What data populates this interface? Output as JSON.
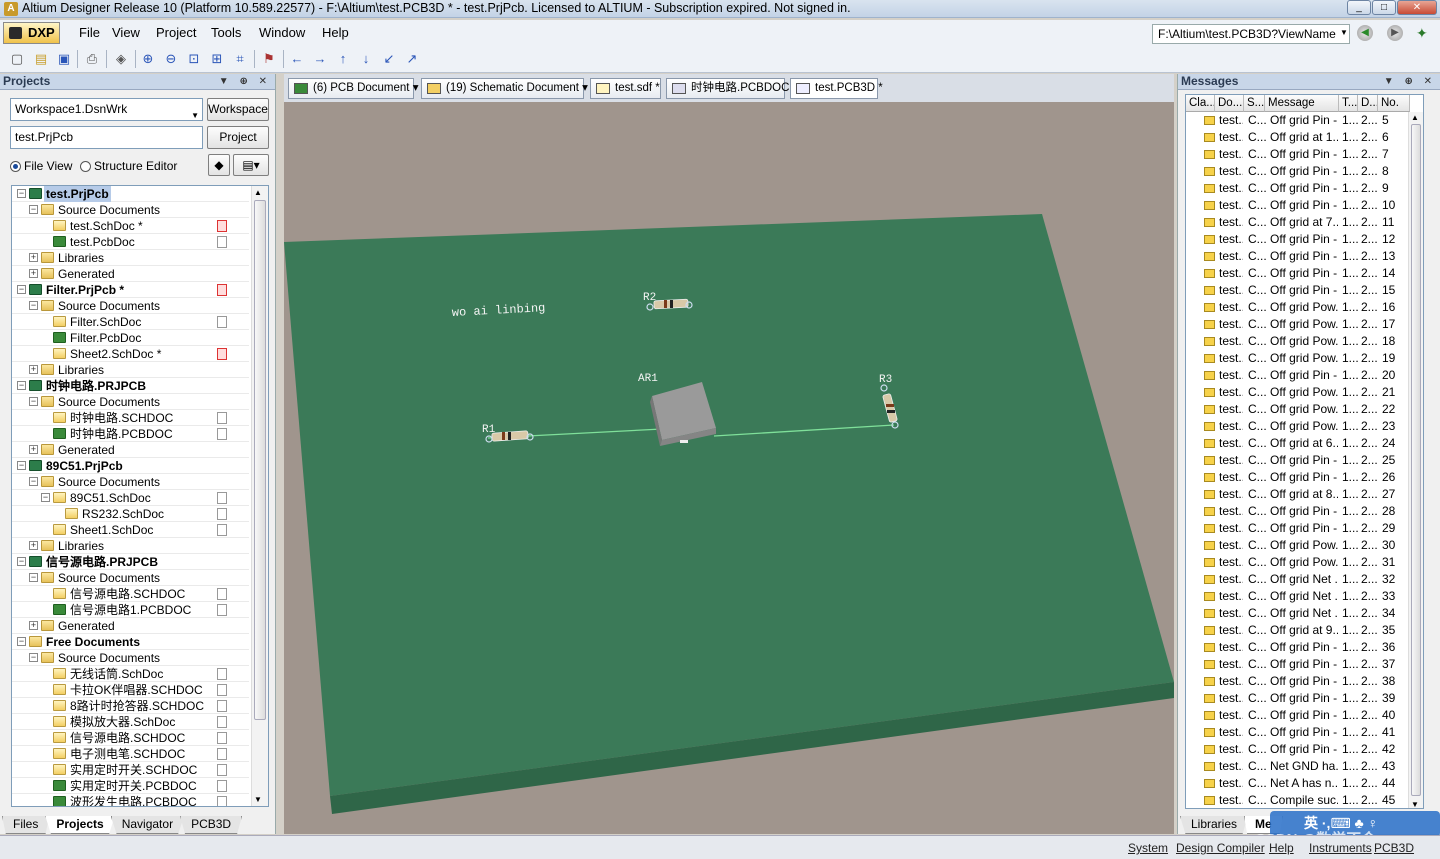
{
  "window": {
    "title": "Altium Designer Release 10 (Platform 10.589.22577) - F:\\Altium\\test.PCB3D * - test.PrjPcb. Licensed to ALTIUM - Subscription expired. Not signed in.",
    "buttons": [
      "_",
      "□",
      "✕"
    ]
  },
  "menubar": {
    "dxp": "DXP",
    "items": [
      "File",
      "View",
      "Project",
      "Tools",
      "Window",
      "Help"
    ],
    "path": "F:\\Altium\\test.PCB3D?ViewName"
  },
  "projects": {
    "title": "Projects",
    "workspace": "Workspace1.DsnWrk",
    "workspace_btn": "Workspace",
    "project": "test.PrjPcb",
    "project_btn": "Project",
    "radio_fileview": "File View",
    "radio_structure": "Structure Editor",
    "tree": [
      {
        "label": "test.PrjPcb",
        "level": 0,
        "icon": "prj",
        "bold": true,
        "selected": true,
        "pm": "−",
        "doc": ""
      },
      {
        "label": "Source Documents",
        "level": 1,
        "icon": "fold",
        "pm": "−",
        "doc": ""
      },
      {
        "label": "test.SchDoc *",
        "level": 2,
        "icon": "sch",
        "doc": "red"
      },
      {
        "label": "test.PcbDoc",
        "level": 2,
        "icon": "pcb",
        "doc": "norm"
      },
      {
        "label": "Libraries",
        "level": 1,
        "icon": "fold",
        "pm": "+",
        "doc": ""
      },
      {
        "label": "Generated",
        "level": 1,
        "icon": "fold",
        "pm": "+",
        "doc": ""
      },
      {
        "label": "Filter.PrjPcb *",
        "level": 0,
        "icon": "prj",
        "bold": true,
        "pm": "−",
        "doc": "red"
      },
      {
        "label": "Source Documents",
        "level": 1,
        "icon": "fold",
        "pm": "−",
        "doc": ""
      },
      {
        "label": "Filter.SchDoc",
        "level": 2,
        "icon": "sch",
        "doc": "norm"
      },
      {
        "label": "Filter.PcbDoc",
        "level": 2,
        "icon": "pcb",
        "doc": ""
      },
      {
        "label": "Sheet2.SchDoc *",
        "level": 2,
        "icon": "sch",
        "doc": "red"
      },
      {
        "label": "Libraries",
        "level": 1,
        "icon": "fold",
        "pm": "+",
        "doc": ""
      },
      {
        "label": "时钟电路.PRJPCB",
        "level": 0,
        "icon": "prj",
        "bold": true,
        "pm": "−",
        "doc": ""
      },
      {
        "label": "Source Documents",
        "level": 1,
        "icon": "fold",
        "pm": "−",
        "doc": ""
      },
      {
        "label": "时钟电路.SCHDOC",
        "level": 2,
        "icon": "sch",
        "doc": "norm"
      },
      {
        "label": "时钟电路.PCBDOC",
        "level": 2,
        "icon": "pcb",
        "doc": "norm"
      },
      {
        "label": "Generated",
        "level": 1,
        "icon": "fold",
        "pm": "+",
        "doc": ""
      },
      {
        "label": "89C51.PrjPcb",
        "level": 0,
        "icon": "prj",
        "bold": true,
        "pm": "−",
        "doc": ""
      },
      {
        "label": "Source Documents",
        "level": 1,
        "icon": "fold",
        "pm": "−",
        "doc": ""
      },
      {
        "label": "89C51.SchDoc",
        "level": 2,
        "icon": "sch",
        "pm": "−",
        "doc": "norm"
      },
      {
        "label": "RS232.SchDoc",
        "level": 3,
        "icon": "sch",
        "doc": "norm"
      },
      {
        "label": "Sheet1.SchDoc",
        "level": 2,
        "icon": "sch",
        "doc": "norm"
      },
      {
        "label": "Libraries",
        "level": 1,
        "icon": "fold",
        "pm": "+",
        "doc": ""
      },
      {
        "label": "信号源电路.PRJPCB",
        "level": 0,
        "icon": "prj",
        "bold": true,
        "pm": "−",
        "doc": ""
      },
      {
        "label": "Source Documents",
        "level": 1,
        "icon": "fold",
        "pm": "−",
        "doc": ""
      },
      {
        "label": "信号源电路.SCHDOC",
        "level": 2,
        "icon": "sch",
        "doc": "norm"
      },
      {
        "label": "信号源电路1.PCBDOC",
        "level": 2,
        "icon": "pcb",
        "doc": "norm"
      },
      {
        "label": "Generated",
        "level": 1,
        "icon": "fold",
        "pm": "+",
        "doc": ""
      },
      {
        "label": "Free Documents",
        "level": 0,
        "icon": "fold",
        "bold": true,
        "pm": "−",
        "doc": ""
      },
      {
        "label": "Source Documents",
        "level": 1,
        "icon": "fold",
        "pm": "−",
        "doc": ""
      },
      {
        "label": "无线话筒.SchDoc",
        "level": 2,
        "icon": "sch",
        "doc": "norm"
      },
      {
        "label": "卡拉OK伴唱器.SCHDOC",
        "level": 2,
        "icon": "sch",
        "doc": "norm"
      },
      {
        "label": "8路计时抢答器.SCHDOC",
        "level": 2,
        "icon": "sch",
        "doc": "norm"
      },
      {
        "label": "模拟放大器.SchDoc",
        "level": 2,
        "icon": "sch",
        "doc": "norm"
      },
      {
        "label": "信号源电路.SCHDOC",
        "level": 2,
        "icon": "sch",
        "doc": "norm"
      },
      {
        "label": "电子测电笔.SCHDOC",
        "level": 2,
        "icon": "sch",
        "doc": "norm"
      },
      {
        "label": "实用定时开关.SCHDOC",
        "level": 2,
        "icon": "sch",
        "doc": "norm"
      },
      {
        "label": "实用定时开关.PCBDOC",
        "level": 2,
        "icon": "pcb",
        "doc": "norm"
      },
      {
        "label": "波形发生电路.PCBDOC",
        "level": 2,
        "icon": "pcb",
        "doc": "norm"
      }
    ],
    "bottom_tabs": [
      "Files",
      "Projects",
      "Navigator",
      "PCB3D"
    ]
  },
  "doctabs": [
    {
      "label": "(6) PCB Document",
      "dropdown": true,
      "icon": "pcb"
    },
    {
      "label": "(19) Schematic Document",
      "dropdown": true,
      "icon": "sch"
    },
    {
      "label": "test.sdf *",
      "dropdown": false,
      "icon": "sdf"
    },
    {
      "label": "时钟电路.PCBDOC",
      "dropdown": false,
      "icon": "pcbdoc"
    },
    {
      "label": "test.PCB3D *",
      "dropdown": false,
      "icon": "pcb3d"
    }
  ],
  "board": {
    "text": "wo ai linbing",
    "r1": "R1",
    "r2": "R2",
    "r3": "R3",
    "ar1": "AR1",
    "board_color": "#3b7a58",
    "bg_color": "#a0958d"
  },
  "messages": {
    "title": "Messages",
    "columns": [
      "Cla...",
      "Do...",
      "S...",
      "Message",
      "T...",
      "D...",
      "No."
    ],
    "rows": [
      [
        "test...",
        "C...",
        "Off grid Pin -...",
        "1...",
        "2...",
        "5"
      ],
      [
        "test...",
        "C...",
        "Off grid  at 1...",
        "1...",
        "2...",
        "6"
      ],
      [
        "test...",
        "C...",
        "Off grid Pin -...",
        "1...",
        "2...",
        "7"
      ],
      [
        "test...",
        "C...",
        "Off grid Pin -...",
        "1...",
        "2...",
        "8"
      ],
      [
        "test...",
        "C...",
        "Off grid Pin -...",
        "1...",
        "2...",
        "9"
      ],
      [
        "test...",
        "C...",
        "Off grid Pin -...",
        "1...",
        "2...",
        "10"
      ],
      [
        "test...",
        "C...",
        "Off grid  at 7...",
        "1...",
        "2...",
        "11"
      ],
      [
        "test...",
        "C...",
        "Off grid Pin -...",
        "1...",
        "2...",
        "12"
      ],
      [
        "test...",
        "C...",
        "Off grid Pin -...",
        "1...",
        "2...",
        "13"
      ],
      [
        "test...",
        "C...",
        "Off grid Pin -...",
        "1...",
        "2...",
        "14"
      ],
      [
        "test...",
        "C...",
        "Off grid Pin -...",
        "1...",
        "2...",
        "15"
      ],
      [
        "test...",
        "C...",
        "Off grid Pow...",
        "1...",
        "2...",
        "16"
      ],
      [
        "test...",
        "C...",
        "Off grid Pow...",
        "1...",
        "2...",
        "17"
      ],
      [
        "test...",
        "C...",
        "Off grid Pow...",
        "1...",
        "2...",
        "18"
      ],
      [
        "test...",
        "C...",
        "Off grid Pow...",
        "1...",
        "2...",
        "19"
      ],
      [
        "test...",
        "C...",
        "Off grid Pin -...",
        "1...",
        "2...",
        "20"
      ],
      [
        "test...",
        "C...",
        "Off grid Pow...",
        "1...",
        "2...",
        "21"
      ],
      [
        "test...",
        "C...",
        "Off grid Pow...",
        "1...",
        "2...",
        "22"
      ],
      [
        "test...",
        "C...",
        "Off grid Pow...",
        "1...",
        "2...",
        "23"
      ],
      [
        "test...",
        "C...",
        "Off grid  at 6...",
        "1...",
        "2...",
        "24"
      ],
      [
        "test...",
        "C...",
        "Off grid Pin -...",
        "1...",
        "2...",
        "25"
      ],
      [
        "test...",
        "C...",
        "Off grid Pin -...",
        "1...",
        "2...",
        "26"
      ],
      [
        "test...",
        "C...",
        "Off grid  at 8...",
        "1...",
        "2...",
        "27"
      ],
      [
        "test...",
        "C...",
        "Off grid Pin -...",
        "1...",
        "2...",
        "28"
      ],
      [
        "test...",
        "C...",
        "Off grid Pin -...",
        "1...",
        "2...",
        "29"
      ],
      [
        "test...",
        "C...",
        "Off grid Pow...",
        "1...",
        "2...",
        "30"
      ],
      [
        "test...",
        "C...",
        "Off grid Pow...",
        "1...",
        "2...",
        "31"
      ],
      [
        "test...",
        "C...",
        "Off grid Net ...",
        "1...",
        "2...",
        "32"
      ],
      [
        "test...",
        "C...",
        "Off grid Net ...",
        "1...",
        "2...",
        "33"
      ],
      [
        "test...",
        "C...",
        "Off grid Net ...",
        "1...",
        "2...",
        "34"
      ],
      [
        "test...",
        "C...",
        "Off grid  at 9...",
        "1...",
        "2...",
        "35"
      ],
      [
        "test...",
        "C...",
        "Off grid Pin -...",
        "1...",
        "2...",
        "36"
      ],
      [
        "test...",
        "C...",
        "Off grid Pin -...",
        "1...",
        "2...",
        "37"
      ],
      [
        "test...",
        "C...",
        "Off grid Pin -...",
        "1...",
        "2...",
        "38"
      ],
      [
        "test...",
        "C...",
        "Off grid Pin -...",
        "1...",
        "2...",
        "39"
      ],
      [
        "test...",
        "C...",
        "Off grid Pin -...",
        "1...",
        "2...",
        "40"
      ],
      [
        "test...",
        "C...",
        "Off grid Pin -...",
        "1...",
        "2...",
        "41"
      ],
      [
        "test...",
        "C...",
        "Off grid Pin -...",
        "1...",
        "2...",
        "42"
      ],
      [
        "test...",
        "C...",
        "Net GND ha...",
        "1...",
        "2...",
        "43"
      ],
      [
        "test...",
        "C...",
        "Net A has n...",
        "1...",
        "2...",
        "44"
      ],
      [
        "test...",
        "C...",
        "Compile suc...",
        "1...",
        "2...",
        "45"
      ]
    ],
    "bottom_tabs": [
      "Libraries",
      "Me"
    ]
  },
  "statusbar": {
    "items": [
      "System",
      "Design Compiler",
      "Help",
      "Instruments",
      "PCB3D"
    ]
  },
  "ime": {
    "text": "英 ·,⌨ ♣ ♀",
    "watermark": "CSDN @数学不会"
  }
}
